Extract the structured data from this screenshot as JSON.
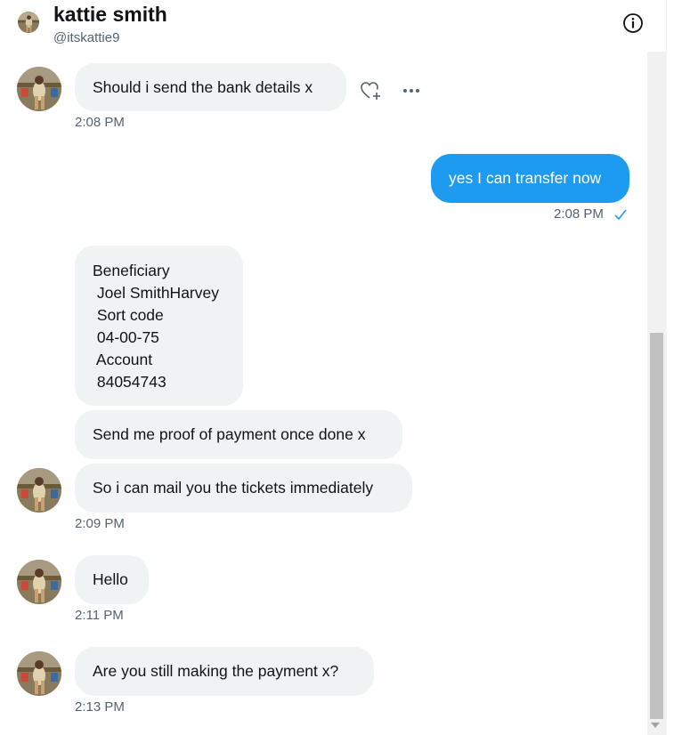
{
  "header": {
    "name": "kattie smith",
    "handle": "@itskattie9"
  },
  "messages": [
    {
      "text": "Should i send the bank details x",
      "time": "2:08 PM"
    },
    {
      "text": "yes I can transfer now",
      "time": "2:08 PM"
    },
    {
      "text": "Beneficiary\n Joel SmithHarvey\n Sort code\n 04-00-75\n Account\n 84054743"
    },
    {
      "text": "Send me proof of payment once done x"
    },
    {
      "text": "So i can mail you the tickets immediately",
      "time": "2:09 PM"
    },
    {
      "text": "Hello",
      "time": "2:11 PM"
    },
    {
      "text": "Are you still making the payment x?",
      "time": "2:13 PM"
    }
  ],
  "colors": {
    "accent": "#1d9bf0",
    "bubble_received": "#eff3f4",
    "muted_text": "#536471"
  },
  "icons": [
    "info-icon",
    "react-heart-icon",
    "more-icon",
    "read-check-icon"
  ]
}
